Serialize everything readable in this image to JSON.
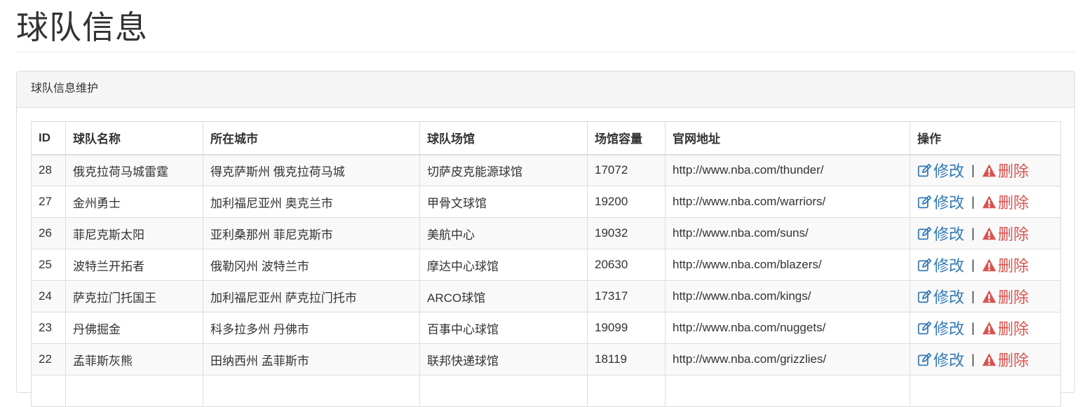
{
  "page": {
    "title": "球队信息"
  },
  "panel": {
    "heading": "球队信息维护"
  },
  "table": {
    "headers": [
      "ID",
      "球队名称",
      "所在城市",
      "球队场馆",
      "场馆容量",
      "官网地址",
      "操作"
    ],
    "rows": [
      {
        "id": "28",
        "name": "俄克拉荷马城雷霆",
        "city": "得克萨斯州 俄克拉荷马城",
        "arena": "切萨皮克能源球馆",
        "capacity": "17072",
        "url": "http://www.nba.com/thunder/"
      },
      {
        "id": "27",
        "name": "金州勇士",
        "city": "加利福尼亚州 奥克兰市",
        "arena": "甲骨文球馆",
        "capacity": "19200",
        "url": "http://www.nba.com/warriors/"
      },
      {
        "id": "26",
        "name": "菲尼克斯太阳",
        "city": "亚利桑那州 菲尼克斯市",
        "arena": "美航中心",
        "capacity": "19032",
        "url": "http://www.nba.com/suns/"
      },
      {
        "id": "25",
        "name": "波特兰开拓者",
        "city": "俄勒冈州 波特兰市",
        "arena": "摩达中心球馆",
        "capacity": "20630",
        "url": "http://www.nba.com/blazers/"
      },
      {
        "id": "24",
        "name": "萨克拉门托国王",
        "city": "加利福尼亚州 萨克拉门托市",
        "arena": "ARCO球馆",
        "capacity": "17317",
        "url": "http://www.nba.com/kings/"
      },
      {
        "id": "23",
        "name": "丹佛掘金",
        "city": "科多拉多州 丹佛市",
        "arena": "百事中心球馆",
        "capacity": "19099",
        "url": "http://www.nba.com/nuggets/"
      },
      {
        "id": "22",
        "name": "孟菲斯灰熊",
        "city": "田纳西州 孟菲斯市",
        "arena": "联邦快递球馆",
        "capacity": "18119",
        "url": "http://www.nba.com/grizzlies/"
      },
      {
        "id": "",
        "name": "",
        "city": "",
        "arena": "",
        "capacity": "",
        "url": ""
      }
    ],
    "actions": {
      "edit_label": "修改",
      "delete_label": "删除",
      "separator": "|",
      "edit_icon": "edit-icon",
      "delete_icon": "warning-icon"
    }
  },
  "colors": {
    "edit": "#337ab7",
    "delete": "#d9534f",
    "panel_heading_bg": "#f5f5f5",
    "row_stripe": "#f9f9f9",
    "border": "#dddddd"
  }
}
